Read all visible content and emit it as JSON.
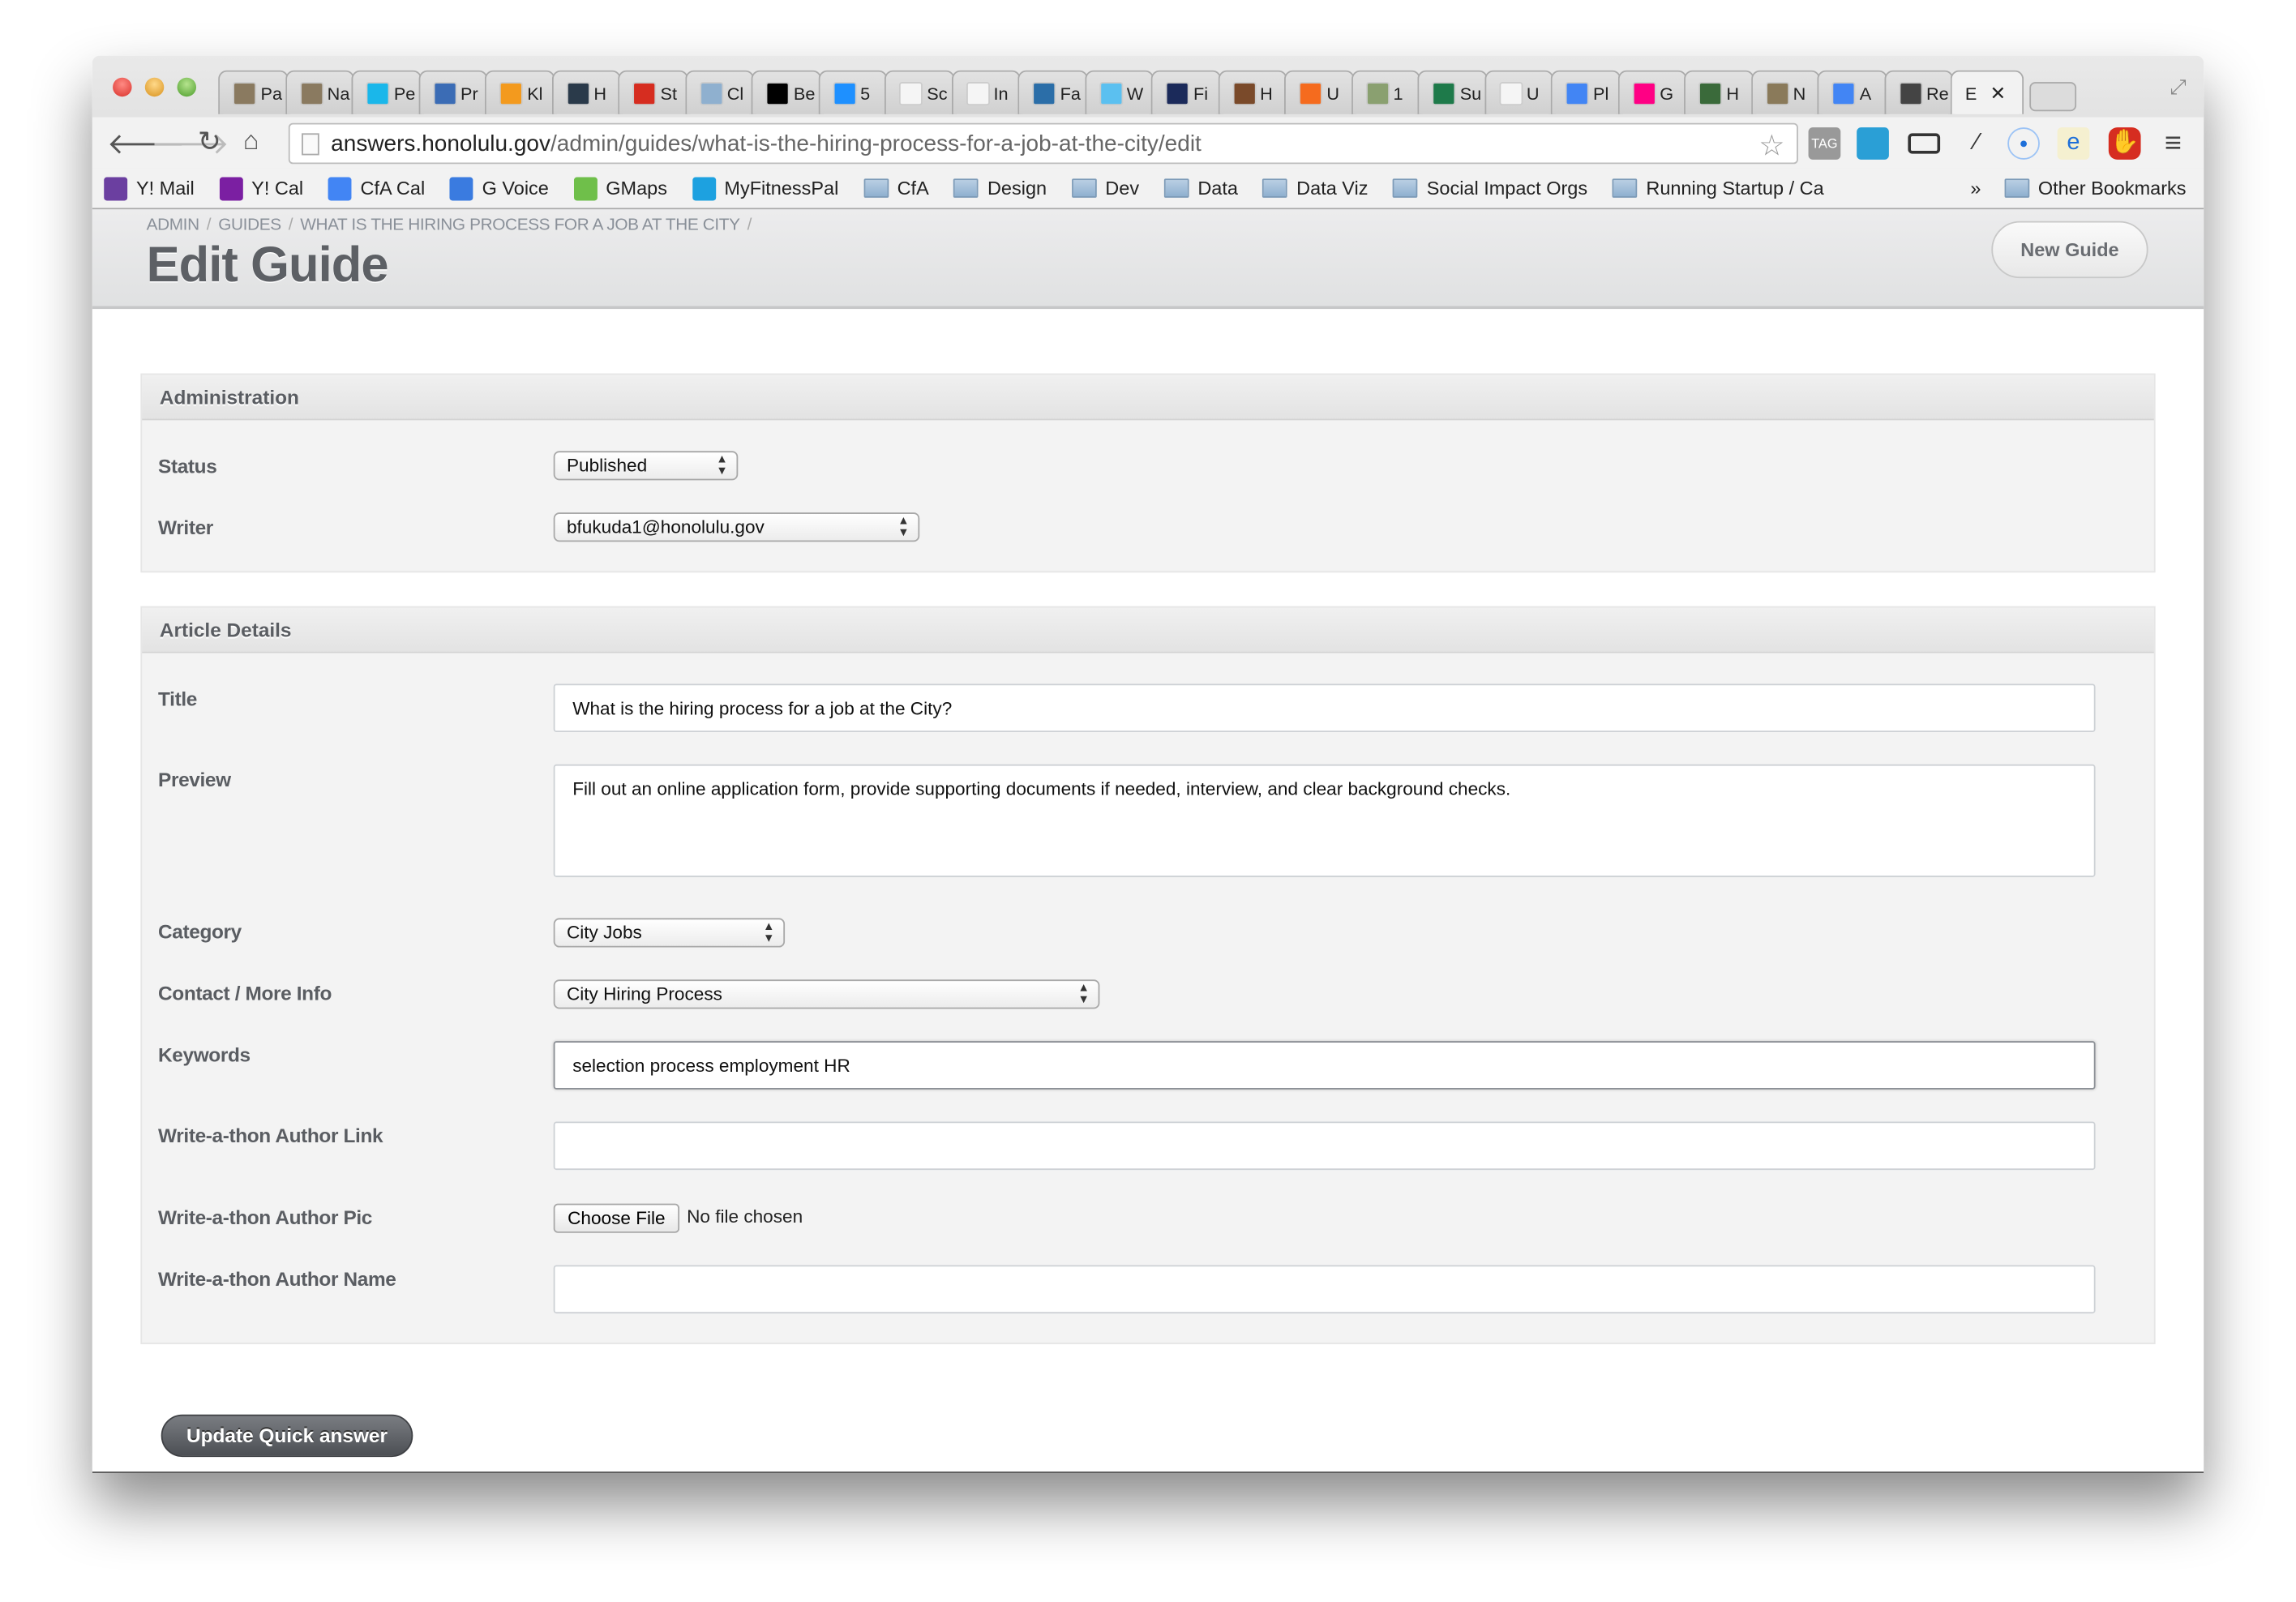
{
  "browser": {
    "tabs": [
      {
        "label": "Pa",
        "color": "#8a7a60"
      },
      {
        "label": "Na",
        "color": "#8a7a60"
      },
      {
        "label": "Pe",
        "color": "#1ab7ea"
      },
      {
        "label": "Pr",
        "color": "#3b6cb5"
      },
      {
        "label": "Kl",
        "color": "#f39a1e"
      },
      {
        "label": "H",
        "color": "#2a3a4a"
      },
      {
        "label": "St",
        "color": "#d62d20"
      },
      {
        "label": "Cl",
        "color": "#8fb0cf"
      },
      {
        "label": "Be",
        "color": "#000000"
      },
      {
        "label": "5",
        "color": "#1e90ff"
      },
      {
        "label": "Sc",
        "color": "#f5f5f5"
      },
      {
        "label": "In",
        "color": "#f5f5f5"
      },
      {
        "label": "Fa",
        "color": "#2b6ea8"
      },
      {
        "label": "W",
        "color": "#5bc0f0"
      },
      {
        "label": "Fi",
        "color": "#1b2a5a"
      },
      {
        "label": "H",
        "color": "#7a4a2a"
      },
      {
        "label": "U",
        "color": "#f56b1e"
      },
      {
        "label": "1",
        "color": "#8aa070"
      },
      {
        "label": "Su",
        "color": "#1e7a4a"
      },
      {
        "label": "U",
        "color": "#f5f5f5"
      },
      {
        "label": "Pl",
        "color": "#4285f4"
      },
      {
        "label": "G",
        "color": "#ff0084"
      },
      {
        "label": "H",
        "color": "#3a6a3a"
      },
      {
        "label": "N",
        "color": "#8a7a5a"
      },
      {
        "label": "A",
        "color": "#4285f4"
      },
      {
        "label": "Re",
        "color": "#444444"
      }
    ],
    "active_tab": {
      "label": "E",
      "close": "✕"
    },
    "url_host": "answers.honolulu.gov",
    "url_path": "/admin/guides/what-is-the-hiring-process-for-a-job-at-the-city/edit",
    "bookmarks": [
      {
        "label": "Y! Mail",
        "type": "icon",
        "color": "#6b3fa0"
      },
      {
        "label": "Y! Cal",
        "type": "icon",
        "color": "#7b1fa2"
      },
      {
        "label": "CfA Cal",
        "type": "icon",
        "color": "#4285f4"
      },
      {
        "label": "G Voice",
        "type": "icon",
        "color": "#3a7be0"
      },
      {
        "label": "GMaps",
        "type": "icon",
        "color": "#6fbf4a"
      },
      {
        "label": "MyFitnessPal",
        "type": "icon",
        "color": "#1da1e0"
      },
      {
        "label": "CfA",
        "type": "folder"
      },
      {
        "label": "Design",
        "type": "folder"
      },
      {
        "label": "Dev",
        "type": "folder"
      },
      {
        "label": "Data",
        "type": "folder"
      },
      {
        "label": "Data Viz",
        "type": "folder"
      },
      {
        "label": "Social Impact Orgs",
        "type": "folder"
      },
      {
        "label": "Running Startup / Ca",
        "type": "folder"
      }
    ],
    "overflow": "»",
    "other_bookmarks": "Other Bookmarks"
  },
  "header": {
    "breadcrumb": [
      "ADMIN",
      "GUIDES",
      "WHAT IS THE HIRING PROCESS FOR A JOB AT THE CITY"
    ],
    "breadcrumb_sep": "/",
    "title": "Edit Guide",
    "new_guide": "New Guide"
  },
  "administration": {
    "heading": "Administration",
    "status_label": "Status",
    "status_value": "Published",
    "writer_label": "Writer",
    "writer_value": "bfukuda1@honolulu.gov"
  },
  "article": {
    "heading": "Article Details",
    "title_label": "Title",
    "title_value": "What is the hiring process for a job at the City?",
    "preview_label": "Preview",
    "preview_value": "Fill out an online application form, provide supporting documents if needed, interview, and clear background checks.",
    "category_label": "Category",
    "category_value": "City Jobs",
    "contact_label": "Contact / More Info",
    "contact_value": "City Hiring Process",
    "keywords_label": "Keywords",
    "keywords_value": "selection process employment HR",
    "author_link_label": "Write-a-thon Author Link",
    "author_link_value": "",
    "author_pic_label": "Write-a-thon Author Pic",
    "choose_file": "Choose File",
    "no_file": "No file chosen",
    "author_name_label": "Write-a-thon Author Name",
    "author_name_value": ""
  },
  "submit": "Update Quick answer",
  "colors": {
    "primary_button": "#5a5d62",
    "label_text": "#5a5d62",
    "panel_bg": "#f3f3f3"
  }
}
